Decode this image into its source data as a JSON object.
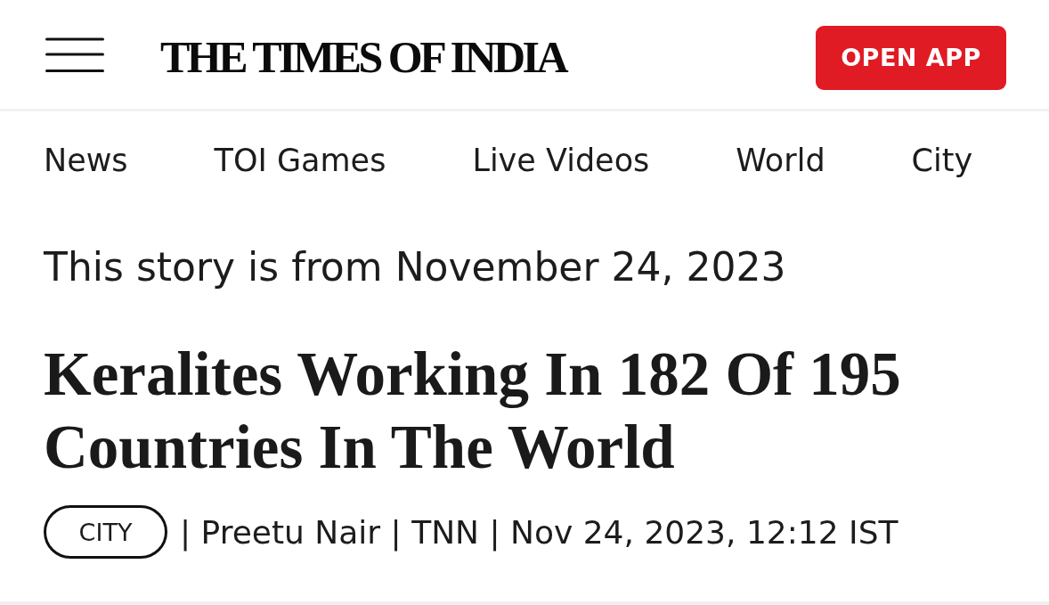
{
  "header": {
    "logo": "THE TIMES OF INDIA",
    "open_app_button": "OPEN APP"
  },
  "nav": [
    "News",
    "TOI Games",
    "Live Videos",
    "World",
    "City"
  ],
  "story_notice": "This story is from November 24, 2023",
  "article": {
    "headline": "Keralites Working In 182 Of 195 Countries In The World",
    "section_tag": "CITY",
    "byline": "| Preetu Nair | TNN | Nov 24, 2023, 12:12 IST"
  }
}
